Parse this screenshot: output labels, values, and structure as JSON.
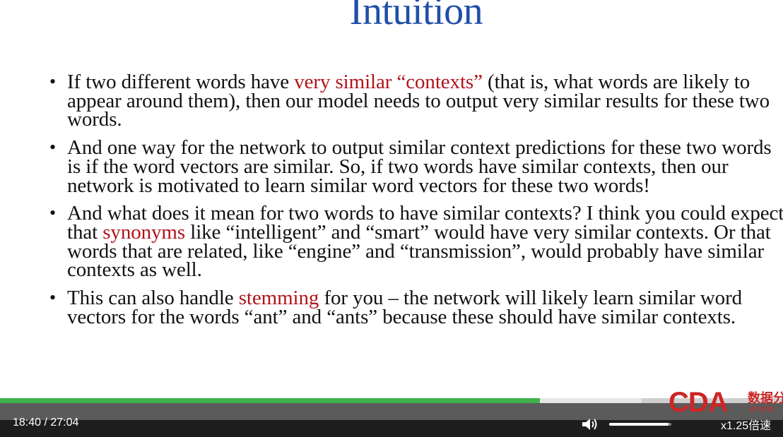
{
  "slide": {
    "title": "Intuition",
    "bullets": [
      {
        "parts": [
          {
            "text": "If two different words have ",
            "hl": false
          },
          {
            "text": "very similar “contexts”",
            "hl": true
          },
          {
            "text": " (that is, what words are likely to appear around them), then our model needs to output very similar results for these two words.",
            "hl": false
          }
        ]
      },
      {
        "parts": [
          {
            "text": "And one way for the network to output similar context predictions for these two words is if the word vectors are similar. So, if two words have similar contexts, then our network is motivated to learn similar word vectors for these two words!",
            "hl": false
          }
        ]
      },
      {
        "parts": [
          {
            "text": "And what does it mean for two words to have similar contexts? I think you could expect that ",
            "hl": false
          },
          {
            "text": "synonyms",
            "hl": true
          },
          {
            "text": " like “intelligent” and “smart” would have very similar contexts. Or that words that are related, like “engine” and “transmission”, would probably have similar contexts as well.",
            "hl": false
          }
        ]
      },
      {
        "parts": [
          {
            "text": "This can also handle ",
            "hl": false
          },
          {
            "text": "stemming",
            "hl": true
          },
          {
            "text": " for you – the network will likely learn similar word vectors for the words “ant” and “ants” because these should have similar contexts.",
            "hl": false
          }
        ]
      }
    ]
  },
  "logo": {
    "text": "CDA",
    "cn": "数据分析",
    "www": "WWW"
  },
  "player": {
    "current_time": "18:40",
    "separator": "/",
    "duration": "27:04",
    "time_display": "18:40 / 27:04",
    "progress_fraction": 0.6897,
    "volume_fraction": 0.95,
    "speed_label": "x1.25倍速",
    "icons": {
      "volume": "speaker-volume-icon"
    },
    "colors": {
      "accent": "#3fb24a",
      "title": "#1f4fa8",
      "highlight": "#b0141a",
      "logo": "#cc2626"
    }
  }
}
